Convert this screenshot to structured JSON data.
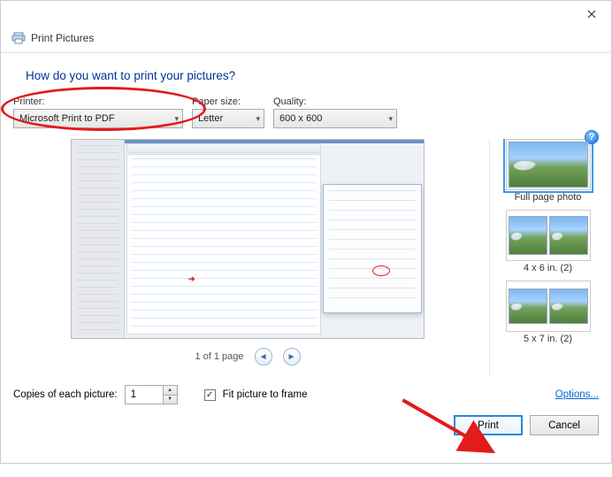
{
  "window": {
    "title": "Print Pictures"
  },
  "question": "How do you want to print your pictures?",
  "labels": {
    "printer": "Printer:",
    "paper": "Paper size:",
    "quality": "Quality:",
    "copies": "Copies of each picture:",
    "fit": "Fit picture to frame",
    "options": "Options...",
    "print": "Print",
    "cancel": "Cancel"
  },
  "selections": {
    "printer": "Microsoft Print to PDF",
    "paper": "Letter",
    "quality": "600 x 600",
    "copies": "1",
    "fit_checked": true
  },
  "pager": {
    "label": "1 of 1 page"
  },
  "layouts": [
    {
      "label": "Full page photo",
      "selected": true,
      "mode": "full"
    },
    {
      "label": "4 x 6 in. (2)",
      "selected": false,
      "mode": "two"
    },
    {
      "label": "5 x 7 in. (2)",
      "selected": false,
      "mode": "two2"
    }
  ]
}
